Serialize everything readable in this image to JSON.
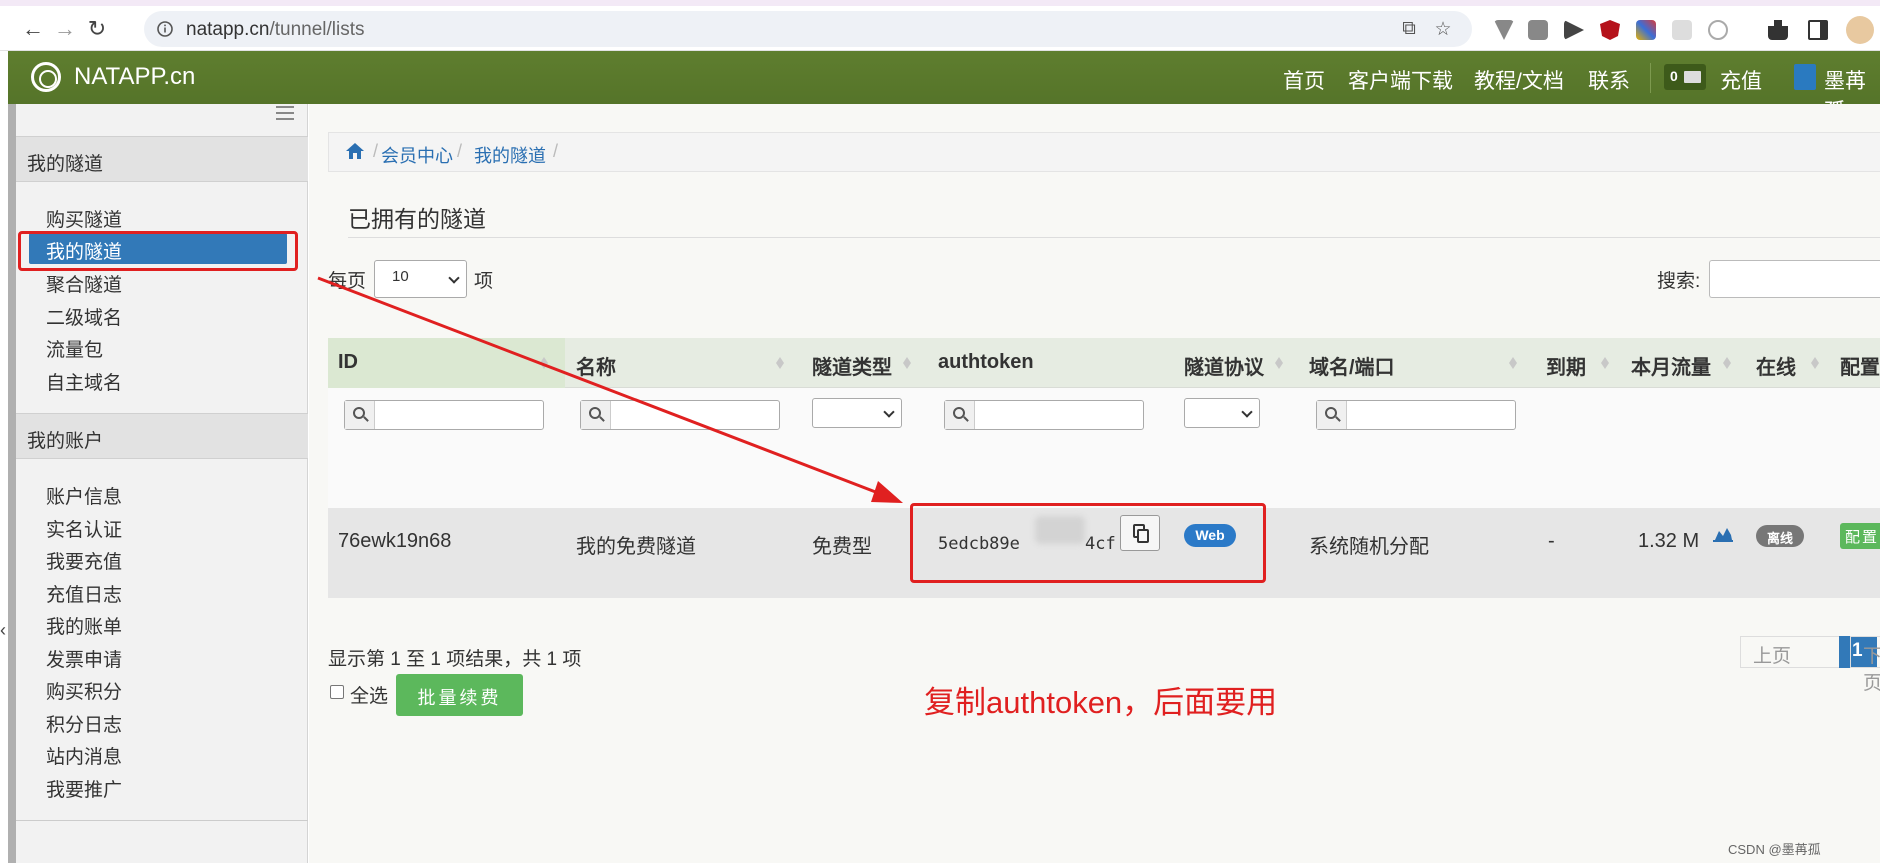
{
  "browser": {
    "url_host": "natapp.cn",
    "url_path": "/tunnel/lists"
  },
  "site": {
    "brand": "NATAPP.cn",
    "nav": [
      "首页",
      "客户端下载",
      "教程/文档",
      "联系"
    ],
    "message_count": "0",
    "recharge": "充值",
    "username": "墨苒孤"
  },
  "sidebar": {
    "section1_title": "我的隧道",
    "section1_items": [
      "购买隧道",
      "我的隧道",
      "聚合隧道",
      "二级域名",
      "流量包",
      "自主域名"
    ],
    "active_item": "我的隧道",
    "section2_title": "我的账户",
    "section2_items": [
      "账户信息",
      "实名认证",
      "我要充值",
      "充值日志",
      "我的账单",
      "发票申请",
      "购买积分",
      "积分日志",
      "站内消息",
      "我要推广"
    ]
  },
  "breadcrumb": [
    "会员中心",
    "我的隧道"
  ],
  "page_title": "已拥有的隧道",
  "controls": {
    "per_page_prefix": "每页",
    "per_page_value": "10",
    "per_page_suffix": "项",
    "search_label": "搜索:"
  },
  "table": {
    "headers": [
      "ID",
      "名称",
      "隧道类型",
      "authtoken",
      "隧道协议",
      "域名/端口",
      "到期",
      "本月流量",
      "在线",
      "配置"
    ],
    "rows": [
      {
        "id": "76ewk19n68",
        "name": "我的免费隧道",
        "type": "免费型",
        "authtoken_start": "5edcb89e",
        "authtoken_end": "4cf",
        "protocol": "Web",
        "domain": "系统随机分配",
        "expire": "-",
        "traffic": "1.32 M",
        "online": "离线",
        "config": "配置"
      }
    ]
  },
  "footer": {
    "info": "显示第 1 至 1 项结果，共 1 项",
    "select_all": "全选",
    "batch_renew": "批量续费",
    "prev": "上页",
    "page": "1",
    "next": "下页"
  },
  "annotation": "复制authtoken，后面要用",
  "watermark": "CSDN @墨苒孤",
  "colors": {
    "header_green": "#5f7e2f",
    "active_blue": "#3279b8",
    "annotation_red": "#e02020",
    "button_green": "#5cb85c"
  },
  "icons": [
    "back-icon",
    "forward-icon",
    "reload-icon",
    "info-icon",
    "share-icon",
    "star-icon",
    "home-icon",
    "search-icon",
    "copy-icon",
    "chart-icon",
    "envelope-icon",
    "user-icon"
  ]
}
